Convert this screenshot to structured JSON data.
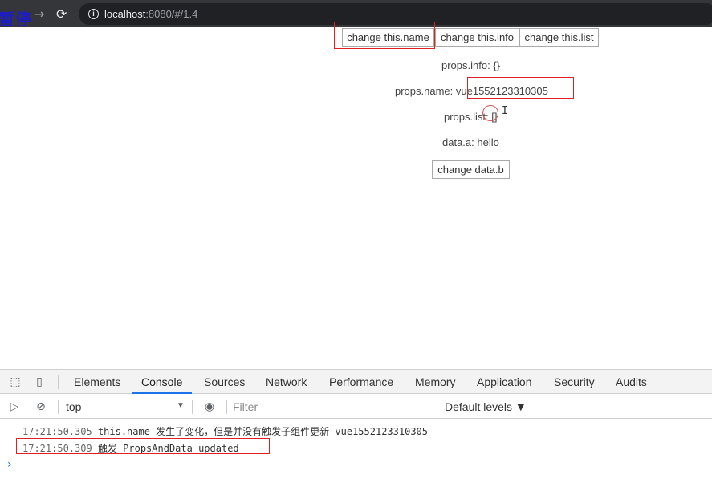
{
  "browser": {
    "overlay_text": "暂停",
    "forward_icon": "→",
    "reload_icon": "⟳",
    "url_host": "localhost",
    "url_rest": ":8080/#/1.4"
  },
  "page": {
    "buttons": {
      "change_name": "change this.name",
      "change_info": "change this.info",
      "change_list": "change this.list",
      "change_data_b": "change data.b"
    },
    "props_info": "props.info: {}",
    "props_name_label": "props.name: ",
    "props_name_value": "vue1552123310305",
    "props_list": "props.list: []",
    "data_a": "data.a: hello"
  },
  "devtools": {
    "tabs": [
      "Elements",
      "Console",
      "Sources",
      "Network",
      "Performance",
      "Memory",
      "Application",
      "Security",
      "Audits"
    ],
    "active_tab": "Console",
    "context": "top",
    "filter_placeholder": "Filter",
    "levels": "Default levels ▼",
    "logs": [
      {
        "time": "17:21:50.305",
        "message": "this.name 发生了变化，但是并没有触发子组件更新 vue1552123310305"
      },
      {
        "time": "17:21:50.309",
        "message": "触发 PropsAndData updated"
      }
    ],
    "prompt_icon": "›"
  },
  "colors": {
    "annotation": "#e02020",
    "tab_active": "#1a73e8",
    "chrome_bg": "#35363a"
  }
}
